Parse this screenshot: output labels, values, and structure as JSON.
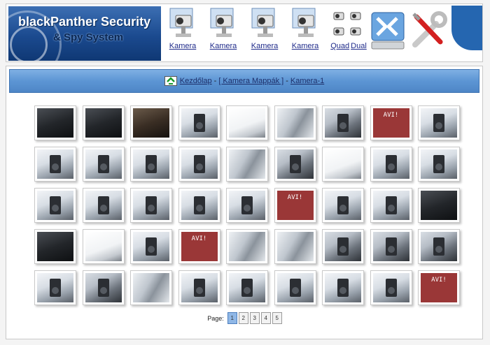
{
  "header": {
    "logo_line1": "blackPanther Security",
    "logo_line2": "& Spy System",
    "cameras": [
      {
        "label": "Kamera"
      },
      {
        "label": "Kamera"
      },
      {
        "label": "Kamera"
      },
      {
        "label": "Kamera"
      }
    ],
    "quad_label": "Quad",
    "dual_label": "Dual"
  },
  "breadcrumb": {
    "home": "Kezdőlap",
    "folders": "[ Kamera Mappák ]",
    "current": "Kamera-1",
    "separator": "-"
  },
  "gallery": {
    "rows": 5,
    "cols": 9,
    "avi_label": "AVI!",
    "thumbnails": [
      "dark",
      "dark",
      "warm",
      "light",
      "white",
      "blur",
      "mid",
      "avi",
      "light",
      "light",
      "light",
      "light",
      "light",
      "blur",
      "mid",
      "white",
      "light",
      "light",
      "light",
      "light",
      "light",
      "light",
      "light",
      "avi",
      "light",
      "light",
      "dark",
      "dark",
      "white",
      "light",
      "avi",
      "blur",
      "blur",
      "mid",
      "mid",
      "mid",
      "light",
      "mid",
      "blur",
      "light",
      "light",
      "light",
      "light",
      "light",
      "avi"
    ]
  },
  "pager": {
    "label": "Page:",
    "pages": [
      "1",
      "2",
      "3",
      "4",
      "5"
    ],
    "current": "1"
  }
}
